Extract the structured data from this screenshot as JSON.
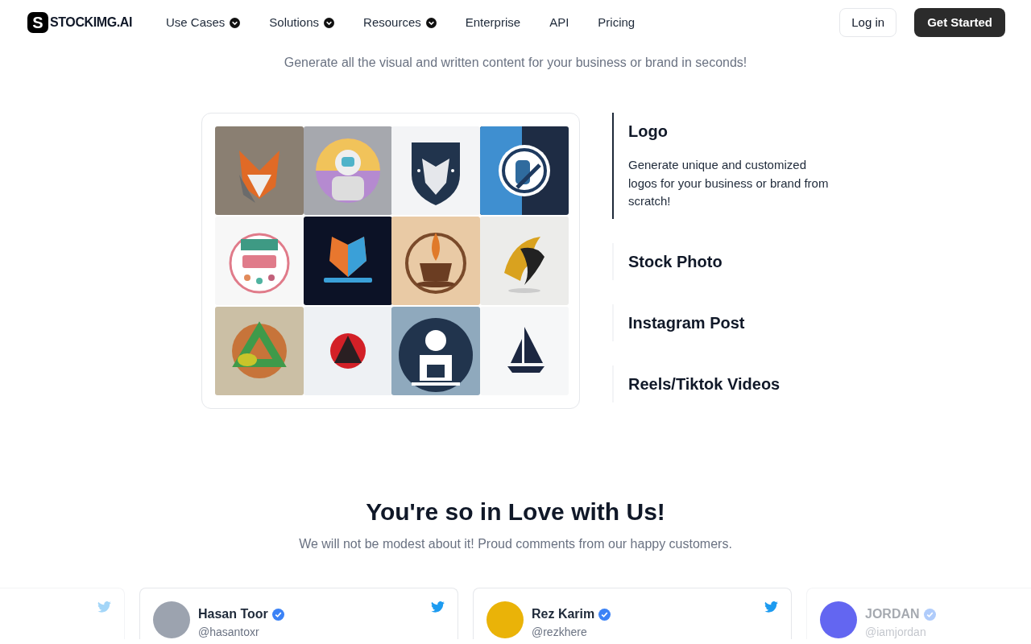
{
  "nav": {
    "logo_mark": "S",
    "logo_text": "STOCKIMG.AI",
    "items": [
      {
        "label": "Use Cases",
        "dropdown": true
      },
      {
        "label": "Solutions",
        "dropdown": true
      },
      {
        "label": "Resources",
        "dropdown": true
      },
      {
        "label": "Enterprise",
        "dropdown": false
      },
      {
        "label": "API",
        "dropdown": false
      },
      {
        "label": "Pricing",
        "dropdown": false
      }
    ],
    "login": "Log in",
    "cta": "Get Started"
  },
  "categories_section": {
    "subtitle": "Generate all the visual and written content for your business or brand in seconds!",
    "categories": [
      {
        "label": "Logo",
        "selected": true,
        "description": "Generate unique and customized logos for your business or brand from scratch!"
      },
      {
        "label": "Stock Photo",
        "selected": false
      },
      {
        "label": "Instagram Post",
        "selected": false
      },
      {
        "label": "Reels/Tiktok Videos",
        "selected": false
      }
    ]
  },
  "testimonials": {
    "title": "You're so in Love with Us!",
    "subtitle": "We will not be modest about it! Proud comments from our happy customers.",
    "cards": [
      {
        "faded": true,
        "twitter_icon": true
      },
      {
        "name": "Hasan Toor",
        "handle": "@hasantoxr",
        "verified": true,
        "faded": false,
        "twitter_icon": true,
        "color": "#9ca3af"
      },
      {
        "name": "Rez Karim",
        "handle": "@rezkhere",
        "verified": true,
        "faded": false,
        "twitter_icon": true,
        "color": "#eab308"
      },
      {
        "name": "JORDAN",
        "handle": "@iamjordan",
        "verified": true,
        "faded": true,
        "twitter_icon": false,
        "color": "#6366f1"
      }
    ]
  }
}
